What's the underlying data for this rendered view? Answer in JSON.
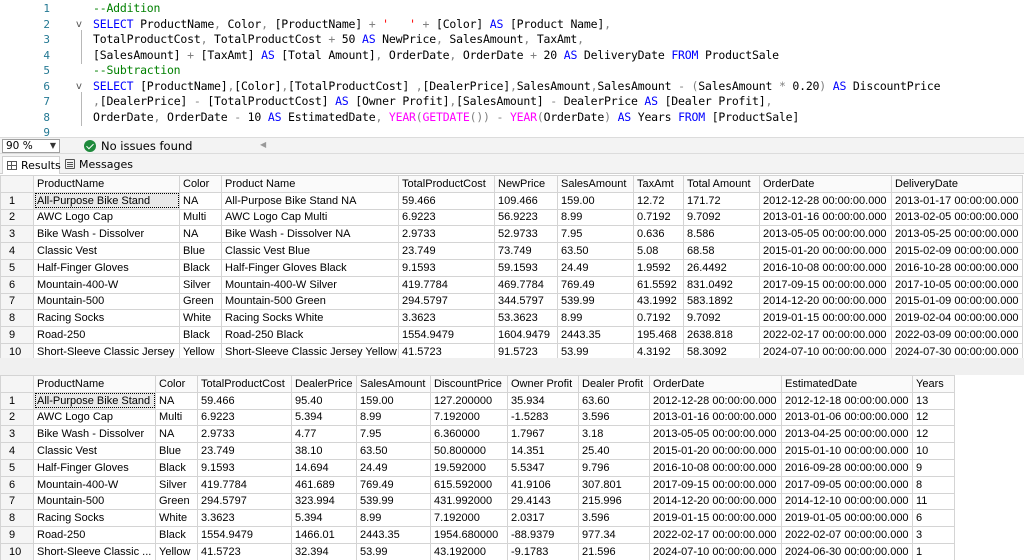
{
  "editor": {
    "lines": [
      {
        "n": "1",
        "fold": "",
        "tokens": [
          [
            "cm",
            "--Addition"
          ]
        ]
      },
      {
        "n": "2",
        "fold": "v",
        "tokens": [
          [
            "kw",
            "SELECT "
          ],
          [
            "id",
            "ProductName"
          ],
          [
            "op",
            ", "
          ],
          [
            "id",
            "Color"
          ],
          [
            "op",
            ", "
          ],
          [
            "id",
            "[ProductName] "
          ],
          [
            "op",
            "+ "
          ],
          [
            "str",
            "'   ' "
          ],
          [
            "op",
            "+ "
          ],
          [
            "id",
            "[Color] "
          ],
          [
            "kw",
            "AS "
          ],
          [
            "id",
            "[Product Name]"
          ],
          [
            "op",
            ","
          ]
        ]
      },
      {
        "n": "3",
        "fold": "",
        "tokens": [
          [
            "id",
            "TotalProductCost"
          ],
          [
            "op",
            ", "
          ],
          [
            "id",
            "TotalProductCost "
          ],
          [
            "op",
            "+ "
          ],
          [
            "num",
            "50 "
          ],
          [
            "kw",
            "AS "
          ],
          [
            "id",
            "NewPrice"
          ],
          [
            "op",
            ", "
          ],
          [
            "id",
            "SalesAmount"
          ],
          [
            "op",
            ", "
          ],
          [
            "id",
            "TaxAmt"
          ],
          [
            "op",
            ","
          ]
        ]
      },
      {
        "n": "4",
        "fold": "",
        "tokens": [
          [
            "id",
            "[SalesAmount] "
          ],
          [
            "op",
            "+ "
          ],
          [
            "id",
            "[TaxAmt] "
          ],
          [
            "kw",
            "AS "
          ],
          [
            "id",
            "[Total Amount]"
          ],
          [
            "op",
            ", "
          ],
          [
            "id",
            "OrderDate"
          ],
          [
            "op",
            ", "
          ],
          [
            "id",
            "OrderDate "
          ],
          [
            "op",
            "+ "
          ],
          [
            "num",
            "20 "
          ],
          [
            "kw",
            "AS "
          ],
          [
            "id",
            "DeliveryDate "
          ],
          [
            "kw",
            "FROM "
          ],
          [
            "id",
            "ProductSale"
          ]
        ]
      },
      {
        "n": "5",
        "fold": "",
        "tokens": [
          [
            "cm",
            "--Subtraction"
          ]
        ]
      },
      {
        "n": "6",
        "fold": "v",
        "tokens": [
          [
            "kw",
            "SELECT "
          ],
          [
            "id",
            "[ProductName]"
          ],
          [
            "op",
            ","
          ],
          [
            "id",
            "[Color]"
          ],
          [
            "op",
            ","
          ],
          [
            "id",
            "[TotalProductCost] "
          ],
          [
            "op",
            ","
          ],
          [
            "id",
            "[DealerPrice]"
          ],
          [
            "op",
            ","
          ],
          [
            "id",
            "SalesAmount"
          ],
          [
            "op",
            ","
          ],
          [
            "id",
            "SalesAmount "
          ],
          [
            "op",
            "- ("
          ],
          [
            "id",
            "SalesAmount "
          ],
          [
            "op",
            "* "
          ],
          [
            "num",
            "0.20"
          ],
          [
            "op",
            ") "
          ],
          [
            "kw",
            "AS "
          ],
          [
            "id",
            "DiscountPrice"
          ]
        ]
      },
      {
        "n": "7",
        "fold": "",
        "tokens": [
          [
            "op",
            ","
          ],
          [
            "id",
            "[DealerPrice] "
          ],
          [
            "op",
            "- "
          ],
          [
            "id",
            "[TotalProductCost] "
          ],
          [
            "kw",
            "AS "
          ],
          [
            "id",
            "[Owner Profit]"
          ],
          [
            "op",
            ","
          ],
          [
            "id",
            "[SalesAmount] "
          ],
          [
            "op",
            "- "
          ],
          [
            "id",
            "DealerPrice "
          ],
          [
            "kw",
            "AS "
          ],
          [
            "id",
            "[Dealer Profit]"
          ],
          [
            "op",
            ","
          ]
        ]
      },
      {
        "n": "8",
        "fold": "",
        "tokens": [
          [
            "id",
            "OrderDate"
          ],
          [
            "op",
            ", "
          ],
          [
            "id",
            "OrderDate "
          ],
          [
            "op",
            "- "
          ],
          [
            "num",
            "10 "
          ],
          [
            "kw",
            "AS "
          ],
          [
            "id",
            "EstimatedDate"
          ],
          [
            "op",
            ", "
          ],
          [
            "fn",
            "YEAR"
          ],
          [
            "op",
            "("
          ],
          [
            "fn",
            "GETDATE"
          ],
          [
            "op",
            "()) - "
          ],
          [
            "fn",
            "YEAR"
          ],
          [
            "op",
            "("
          ],
          [
            "id",
            "OrderDate"
          ],
          [
            "op",
            ") "
          ],
          [
            "kw",
            "AS "
          ],
          [
            "id",
            "Years "
          ],
          [
            "kw",
            "FROM "
          ],
          [
            "id",
            "[ProductSale]"
          ]
        ]
      },
      {
        "n": "9",
        "fold": "",
        "tokens": []
      }
    ]
  },
  "status": {
    "zoom": "90 %",
    "issues": "No issues found"
  },
  "tabs": [
    {
      "label": "Results",
      "icon": "grid-icon",
      "active": true
    },
    {
      "label": "Messages",
      "icon": "messages-icon",
      "active": false
    }
  ],
  "grid1": {
    "columns": [
      "ProductName",
      "Color",
      "Product Name",
      "TotalProductCost",
      "NewPrice",
      "SalesAmount",
      "TaxAmt",
      "Total Amount",
      "OrderDate",
      "DeliveryDate"
    ],
    "rows": [
      [
        "1",
        "All-Purpose Bike Stand",
        "NA",
        "All-Purpose Bike Stand  NA",
        "59.466",
        "109.466",
        "159.00",
        "12.72",
        "171.72",
        "2012-12-28 00:00:00.000",
        "2013-01-17 00:00:00.000"
      ],
      [
        "2",
        "AWC Logo Cap",
        "Multi",
        "AWC Logo Cap  Multi",
        "6.9223",
        "56.9223",
        "8.99",
        "0.7192",
        "9.7092",
        "2013-01-16 00:00:00.000",
        "2013-02-05 00:00:00.000"
      ],
      [
        "3",
        "Bike Wash - Dissolver",
        "NA",
        "Bike Wash - Dissolver  NA",
        "2.9733",
        "52.9733",
        "7.95",
        "0.636",
        "8.586",
        "2013-05-05 00:00:00.000",
        "2013-05-25 00:00:00.000"
      ],
      [
        "4",
        "Classic Vest",
        "Blue",
        "Classic Vest  Blue",
        "23.749",
        "73.749",
        "63.50",
        "5.08",
        "68.58",
        "2015-01-20 00:00:00.000",
        "2015-02-09 00:00:00.000"
      ],
      [
        "5",
        "Half-Finger Gloves",
        "Black",
        "Half-Finger Gloves  Black",
        "9.1593",
        "59.1593",
        "24.49",
        "1.9592",
        "26.4492",
        "2016-10-08 00:00:00.000",
        "2016-10-28 00:00:00.000"
      ],
      [
        "6",
        "Mountain-400-W",
        "Silver",
        "Mountain-400-W  Silver",
        "419.7784",
        "469.7784",
        "769.49",
        "61.5592",
        "831.0492",
        "2017-09-15 00:00:00.000",
        "2017-10-05 00:00:00.000"
      ],
      [
        "7",
        "Mountain-500",
        "Green",
        "Mountain-500  Green",
        "294.5797",
        "344.5797",
        "539.99",
        "43.1992",
        "583.1892",
        "2014-12-20 00:00:00.000",
        "2015-01-09 00:00:00.000"
      ],
      [
        "8",
        "Racing Socks",
        "White",
        "Racing Socks  White",
        "3.3623",
        "53.3623",
        "8.99",
        "0.7192",
        "9.7092",
        "2019-01-15 00:00:00.000",
        "2019-02-04 00:00:00.000"
      ],
      [
        "9",
        "Road-250",
        "Black",
        "Road-250  Black",
        "1554.9479",
        "1604.9479",
        "2443.35",
        "195.468",
        "2638.818",
        "2022-02-17 00:00:00.000",
        "2022-03-09 00:00:00.000"
      ],
      [
        "10",
        "Short-Sleeve Classic Jersey",
        "Yellow",
        "Short-Sleeve Classic Jersey  Yellow",
        "41.5723",
        "91.5723",
        "53.99",
        "4.3192",
        "58.3092",
        "2024-07-10 00:00:00.000",
        "2024-07-30 00:00:00.000"
      ]
    ]
  },
  "grid2": {
    "columns": [
      "ProductName",
      "Color",
      "TotalProductCost",
      "DealerPrice",
      "SalesAmount",
      "DiscountPrice",
      "Owner Profit",
      "Dealer Profit",
      "OrderDate",
      "EstimatedDate",
      "Years"
    ],
    "rows": [
      [
        "1",
        "All-Purpose Bike Stand",
        "NA",
        "59.466",
        "95.40",
        "159.00",
        "127.200000",
        "35.934",
        "63.60",
        "2012-12-28 00:00:00.000",
        "2012-12-18 00:00:00.000",
        "13"
      ],
      [
        "2",
        "AWC Logo Cap",
        "Multi",
        "6.9223",
        "5.394",
        "8.99",
        "7.192000",
        "-1.5283",
        "3.596",
        "2013-01-16 00:00:00.000",
        "2013-01-06 00:00:00.000",
        "12"
      ],
      [
        "3",
        "Bike Wash - Dissolver",
        "NA",
        "2.9733",
        "4.77",
        "7.95",
        "6.360000",
        "1.7967",
        "3.18",
        "2013-05-05 00:00:00.000",
        "2013-04-25 00:00:00.000",
        "12"
      ],
      [
        "4",
        "Classic Vest",
        "Blue",
        "23.749",
        "38.10",
        "63.50",
        "50.800000",
        "14.351",
        "25.40",
        "2015-01-20 00:00:00.000",
        "2015-01-10 00:00:00.000",
        "10"
      ],
      [
        "5",
        "Half-Finger Gloves",
        "Black",
        "9.1593",
        "14.694",
        "24.49",
        "19.592000",
        "5.5347",
        "9.796",
        "2016-10-08 00:00:00.000",
        "2016-09-28 00:00:00.000",
        "9"
      ],
      [
        "6",
        "Mountain-400-W",
        "Silver",
        "419.7784",
        "461.689",
        "769.49",
        "615.592000",
        "41.9106",
        "307.801",
        "2017-09-15 00:00:00.000",
        "2017-09-05 00:00:00.000",
        "8"
      ],
      [
        "7",
        "Mountain-500",
        "Green",
        "294.5797",
        "323.994",
        "539.99",
        "431.992000",
        "29.4143",
        "215.996",
        "2014-12-20 00:00:00.000",
        "2014-12-10 00:00:00.000",
        "11"
      ],
      [
        "8",
        "Racing Socks",
        "White",
        "3.3623",
        "5.394",
        "8.99",
        "7.192000",
        "2.0317",
        "3.596",
        "2019-01-15 00:00:00.000",
        "2019-01-05 00:00:00.000",
        "6"
      ],
      [
        "9",
        "Road-250",
        "Black",
        "1554.9479",
        "1466.01",
        "2443.35",
        "1954.680000",
        "-88.9379",
        "977.34",
        "2022-02-17 00:00:00.000",
        "2022-02-07 00:00:00.000",
        "3"
      ],
      [
        "10",
        "Short-Sleeve Classic ...",
        "Yellow",
        "41.5723",
        "32.394",
        "53.99",
        "43.192000",
        "-9.1783",
        "21.596",
        "2024-07-10 00:00:00.000",
        "2024-06-30 00:00:00.000",
        "1"
      ]
    ]
  },
  "colors": {
    "keyword": "#0000ff",
    "comment": "#008000",
    "function": "#ff00ff",
    "operator": "#808080",
    "line_number": "#237893",
    "ok_status": "#1e8a3c"
  }
}
